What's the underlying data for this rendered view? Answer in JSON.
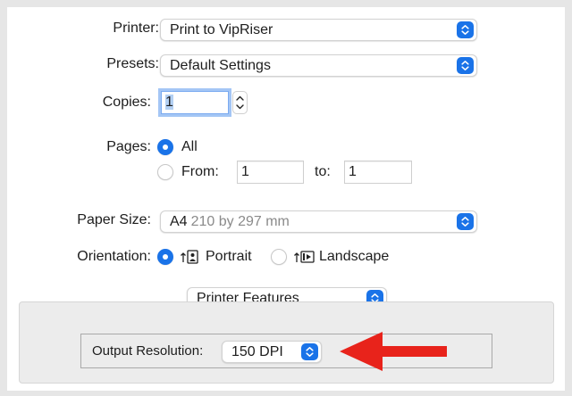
{
  "printer": {
    "label": "Printer:",
    "value": "Print to VipRiser"
  },
  "presets": {
    "label": "Presets:",
    "value": "Default Settings"
  },
  "copies": {
    "label": "Copies:",
    "value": "1"
  },
  "pages": {
    "label": "Pages:",
    "all_label": "All",
    "all_selected": true,
    "from_label": "From:",
    "from_value": "1",
    "to_label": "to:",
    "to_value": "1"
  },
  "paper_size": {
    "label": "Paper Size:",
    "value": "A4",
    "detail": "210 by 297 mm"
  },
  "orientation": {
    "label": "Orientation:",
    "portrait_label": "Portrait",
    "landscape_label": "Landscape",
    "selected": "portrait"
  },
  "features_popup": {
    "value": "Printer Features"
  },
  "output_resolution": {
    "label": "Output Resolution:",
    "value": "150 DPI"
  },
  "colors": {
    "accent": "#1a73e8",
    "arrow": "#e8231b"
  },
  "icons": [
    "stepper-arrows-icon",
    "portrait-orientation-icon",
    "landscape-orientation-icon",
    "red-arrow-annotation"
  ]
}
